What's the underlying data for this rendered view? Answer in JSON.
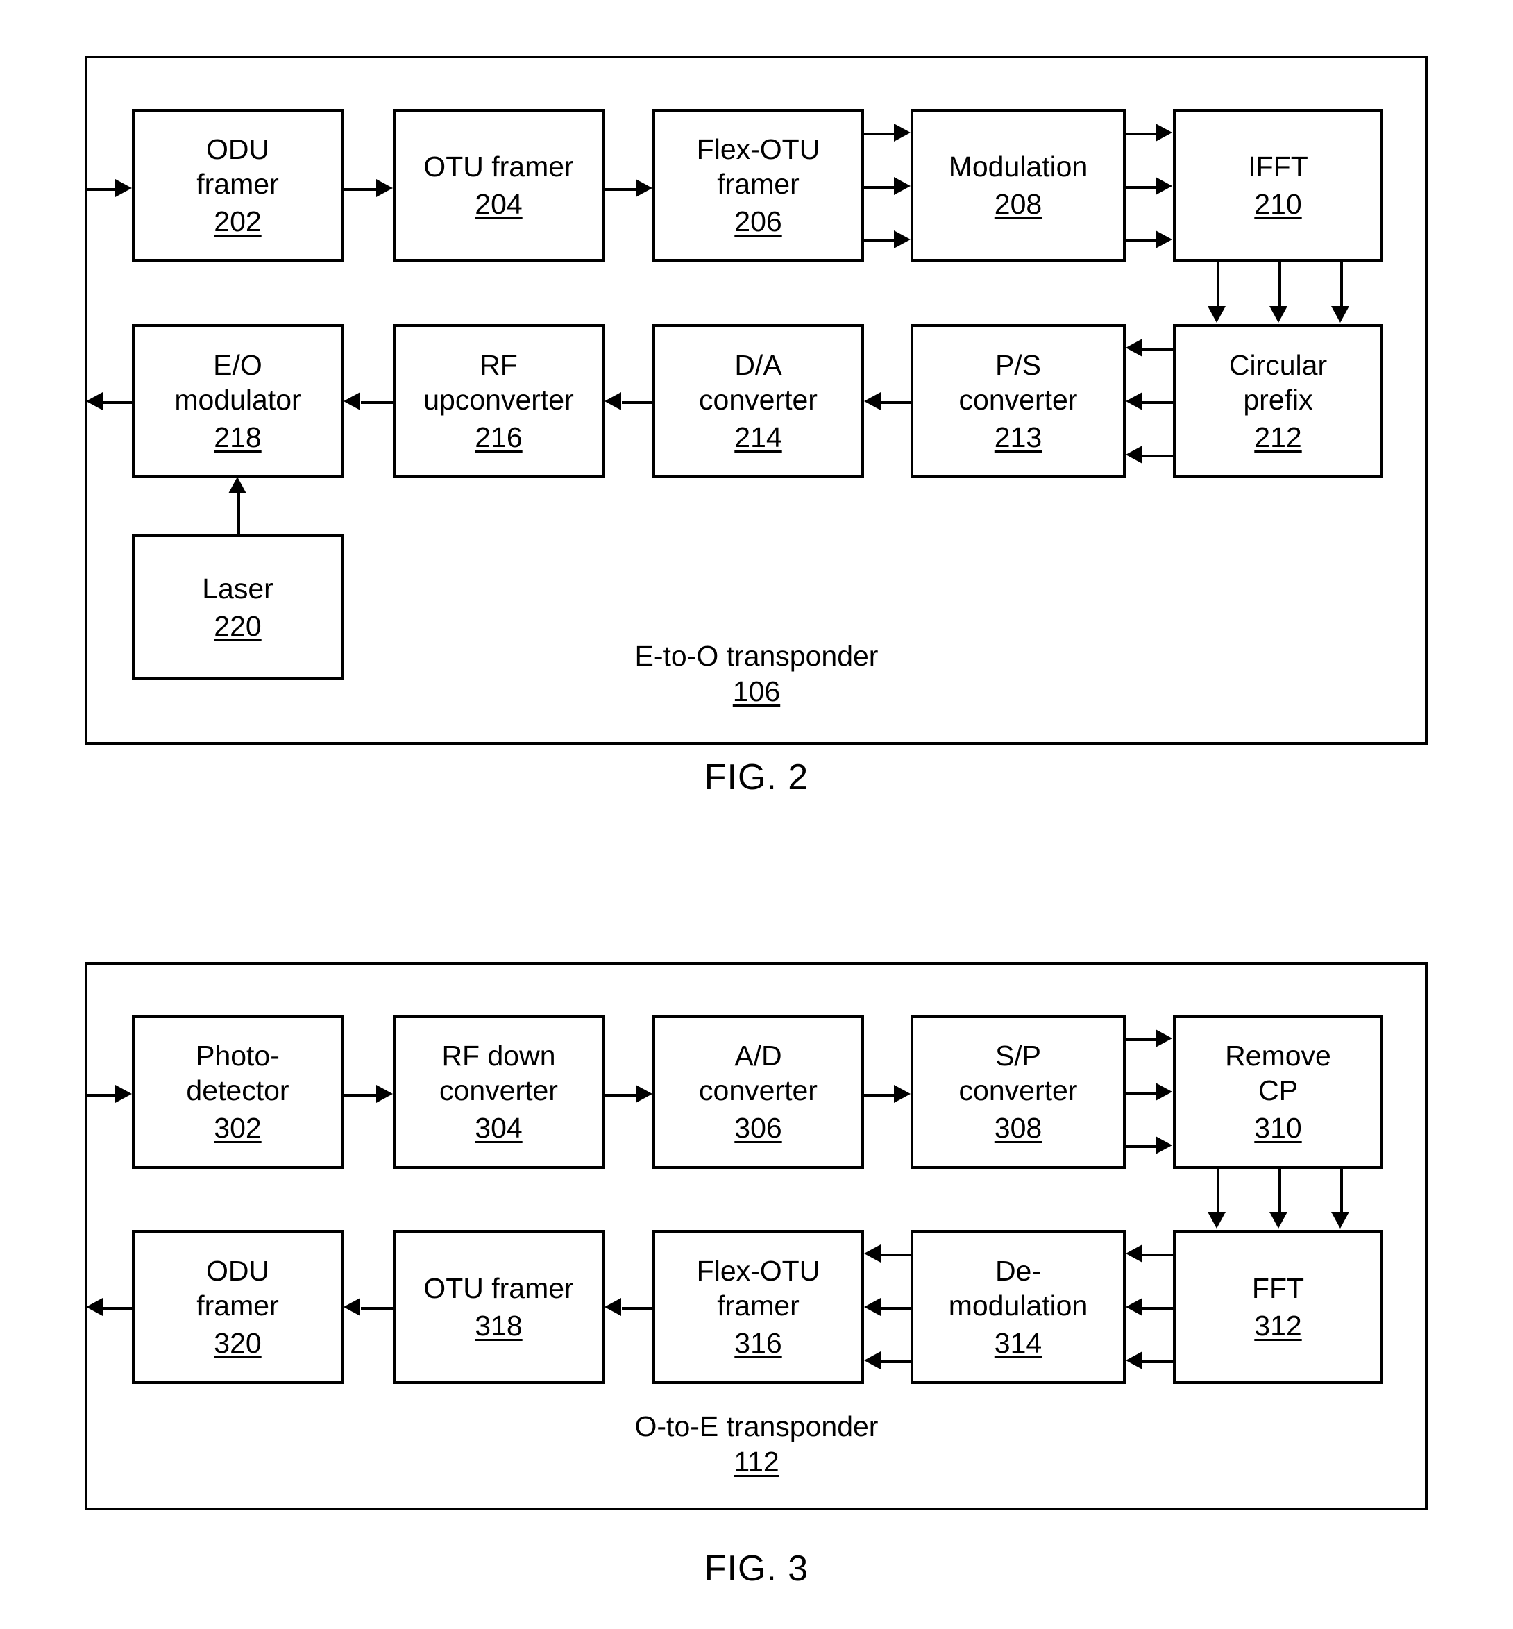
{
  "figures": [
    {
      "id": "fig2",
      "title": "FIG. 2",
      "container_label": "E-to-O transponder",
      "container_number": "106",
      "blocks": [
        {
          "key": "odu_framer_202",
          "label": "ODU\nframer",
          "number": "202"
        },
        {
          "key": "otu_framer_204",
          "label": "OTU framer",
          "number": "204"
        },
        {
          "key": "flex_otu_framer_206",
          "label": "Flex-OTU\nframer",
          "number": "206"
        },
        {
          "key": "modulation_208",
          "label": "Modulation",
          "number": "208"
        },
        {
          "key": "ifft_210",
          "label": "IFFT",
          "number": "210"
        },
        {
          "key": "circular_prefix_212",
          "label": "Circular\nprefix",
          "number": "212"
        },
        {
          "key": "ps_converter_213",
          "label": "P/S\nconverter",
          "number": "213"
        },
        {
          "key": "da_converter_214",
          "label": "D/A\nconverter",
          "number": "214"
        },
        {
          "key": "rf_upconverter_216",
          "label": "RF\nupconverter",
          "number": "216"
        },
        {
          "key": "eo_modulator_218",
          "label": "E/O\nmodulator",
          "number": "218"
        },
        {
          "key": "laser_220",
          "label": "Laser",
          "number": "220"
        }
      ]
    },
    {
      "id": "fig3",
      "title": "FIG. 3",
      "container_label": "O-to-E transponder",
      "container_number": "112",
      "blocks": [
        {
          "key": "photodetector_302",
          "label": "Photo-\ndetector",
          "number": "302"
        },
        {
          "key": "rf_downconverter_304",
          "label": "RF down\nconverter",
          "number": "304"
        },
        {
          "key": "ad_converter_306",
          "label": "A/D\nconverter",
          "number": "306"
        },
        {
          "key": "sp_converter_308",
          "label": "S/P\nconverter",
          "number": "308"
        },
        {
          "key": "remove_cp_310",
          "label": "Remove\nCP",
          "number": "310"
        },
        {
          "key": "fft_312",
          "label": "FFT",
          "number": "312"
        },
        {
          "key": "demodulation_314",
          "label": "De-\nmodulation",
          "number": "314"
        },
        {
          "key": "flex_otu_framer_316",
          "label": "Flex-OTU\nframer",
          "number": "316"
        },
        {
          "key": "otu_framer_318",
          "label": "OTU framer",
          "number": "318"
        },
        {
          "key": "odu_framer_320",
          "label": "ODU\nframer",
          "number": "320"
        }
      ]
    }
  ],
  "colors": {
    "line": "#000000",
    "background": "#ffffff"
  }
}
